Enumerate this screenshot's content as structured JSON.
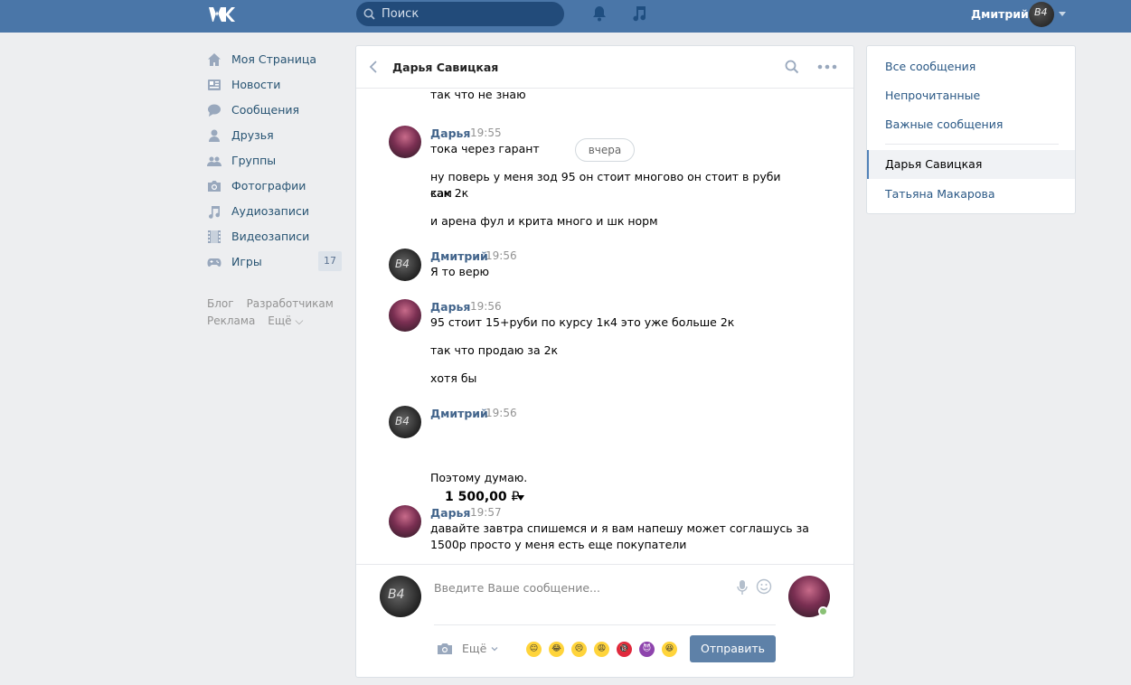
{
  "header": {
    "logo": "vk-logo",
    "search_placeholder": "Поиск",
    "user_name": "Дмитрий",
    "user_avatar_text": "B4"
  },
  "nav": {
    "items": [
      {
        "label": "Моя Страница",
        "icon": "home-icon"
      },
      {
        "label": "Новости",
        "icon": "news-icon"
      },
      {
        "label": "Сообщения",
        "icon": "messages-icon"
      },
      {
        "label": "Друзья",
        "icon": "friends-icon"
      },
      {
        "label": "Группы",
        "icon": "groups-icon"
      },
      {
        "label": "Фотографии",
        "icon": "camera-icon"
      },
      {
        "label": "Аудиозаписи",
        "icon": "music-icon"
      },
      {
        "label": "Видеозаписи",
        "icon": "video-icon"
      },
      {
        "label": "Игры",
        "icon": "gamepad-icon",
        "badge": "17"
      }
    ],
    "footer": {
      "blog": "Блог",
      "developers": "Разработчикам",
      "ads": "Реклама",
      "more": "Ещё ⌵"
    }
  },
  "chat": {
    "peer_name": "Дарья Савицкая",
    "date_separator": "вчера",
    "messages": [
      {
        "lines": [
          "так что не знаю"
        ]
      },
      {
        "author": "Дарья",
        "time": "19:55",
        "lines": [
          "тока через гарант",
          "ну поверь у меня зод 95 он стоит многово он стоит в руби сам",
          "как 2к",
          "и арена фул и крита много и шк норм"
        ]
      },
      {
        "author": "Дмитрий",
        "time": "19:56",
        "lines": [
          "Я то верю"
        ]
      },
      {
        "author": "Дарья",
        "time": "19:56",
        "lines": [
          "95 стоит 15+руби по курсу 1к4 это уже больше 2к",
          "так что продаю за 2к",
          "хотя бы"
        ]
      },
      {
        "author": "Дмитрий",
        "time": "19:56",
        "amount": "1 500,00",
        "currency": "₽",
        "lines": [
          "Поэтому думаю."
        ]
      },
      {
        "author": "Дарья",
        "time": "19:57",
        "lines": [
          "давайте завтра спишемся и я вам напешу может соглашусь за",
          "1500р просто у меня есть еще покупатели"
        ]
      }
    ],
    "composer": {
      "placeholder": "Введите Ваше сообщение...",
      "more_label": "Ещё",
      "send_label": "Отправить",
      "emojis": [
        "😐",
        "😂",
        "😣",
        "😩",
        "🔞",
        "😈",
        "😆"
      ]
    }
  },
  "right_panel": {
    "all": "Все сообщения",
    "unread": "Непрочитанные",
    "important": "Важные сообщения",
    "active_chat": "Дарья Савицкая",
    "other_chat": "Татьяна Макарова"
  },
  "colors": {
    "header": "#4a76a8",
    "link": "#2a5885",
    "author": "#42648b",
    "send_button": "#5e81a8"
  }
}
